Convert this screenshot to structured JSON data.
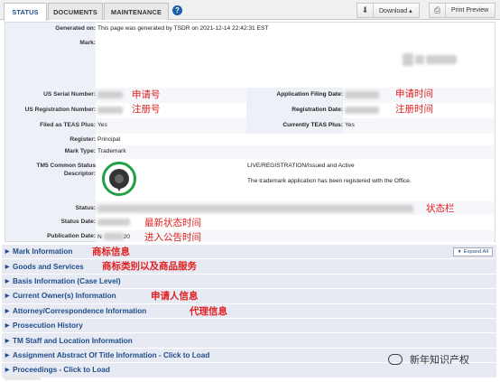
{
  "tabs": [
    {
      "label": "STATUS"
    },
    {
      "label": "DOCUMENTS"
    },
    {
      "label": "MAINTENANCE"
    }
  ],
  "toolbar": {
    "download_label": "Download ▴",
    "print_label": "Print Preview"
  },
  "fields": {
    "generated_label": "Generated on:",
    "generated_value": "This page was generated by TSDR on 2021-12-14 22:42:31 EST",
    "mark_label": "Mark:",
    "serial_label": "US Serial Number:",
    "filing_label": "Application Filing Date:",
    "reg_num_label": "US Registration Number:",
    "reg_date_label": "Registration Date:",
    "teas_label": "Filed as TEAS Plus:",
    "teas_value": "Yes",
    "cur_teas_label": "Currently TEAS Plus:",
    "cur_teas_value": "Yes",
    "register_label": "Register:",
    "register_value": "Principal",
    "marktype_label": "Mark Type:",
    "marktype_value": "Trademark",
    "tm5_label_1": "TM5 Common Status",
    "tm5_label_2": "Descriptor:",
    "tm5_status": "LIVE/REGISTRATION/Issued and Active",
    "tm5_desc": "The trademark application has been registered with the Office.",
    "status_label": "Status:",
    "status_date_label": "Status Date:",
    "pub_date_label": "Publication Date:",
    "pub_date_partial": "N",
    "pub_date_tail": "20"
  },
  "annotations": {
    "serial": "申请号",
    "filing": "申请时间",
    "reg_num": "注册号",
    "reg_date": "注册时间",
    "status": "状态栏",
    "status_date": "最新状态时间",
    "pub_date": "进入公告时间",
    "mark_info": "商标信息",
    "goods": "商标类别以及商品服务",
    "owner": "申请人信息",
    "attorney": "代理信息"
  },
  "sections": [
    {
      "label": "Mark Information"
    },
    {
      "label": "Goods and Services"
    },
    {
      "label": "Basis Information (Case Level)"
    },
    {
      "label": "Current Owner(s) Information"
    },
    {
      "label": "Attorney/Correspondence Information"
    },
    {
      "label": "Prosecution History"
    },
    {
      "label": "TM Staff and Location Information"
    },
    {
      "label": "Assignment Abstract Of Title Information - Click to Load"
    },
    {
      "label": "Proceedings - Click to Load"
    }
  ],
  "expand_all": "Expand All",
  "watermark": "新年知识产权",
  "colors": {
    "link": "#1f4d8c",
    "annotation": "#e02020",
    "seal_ring": "#22a045"
  }
}
